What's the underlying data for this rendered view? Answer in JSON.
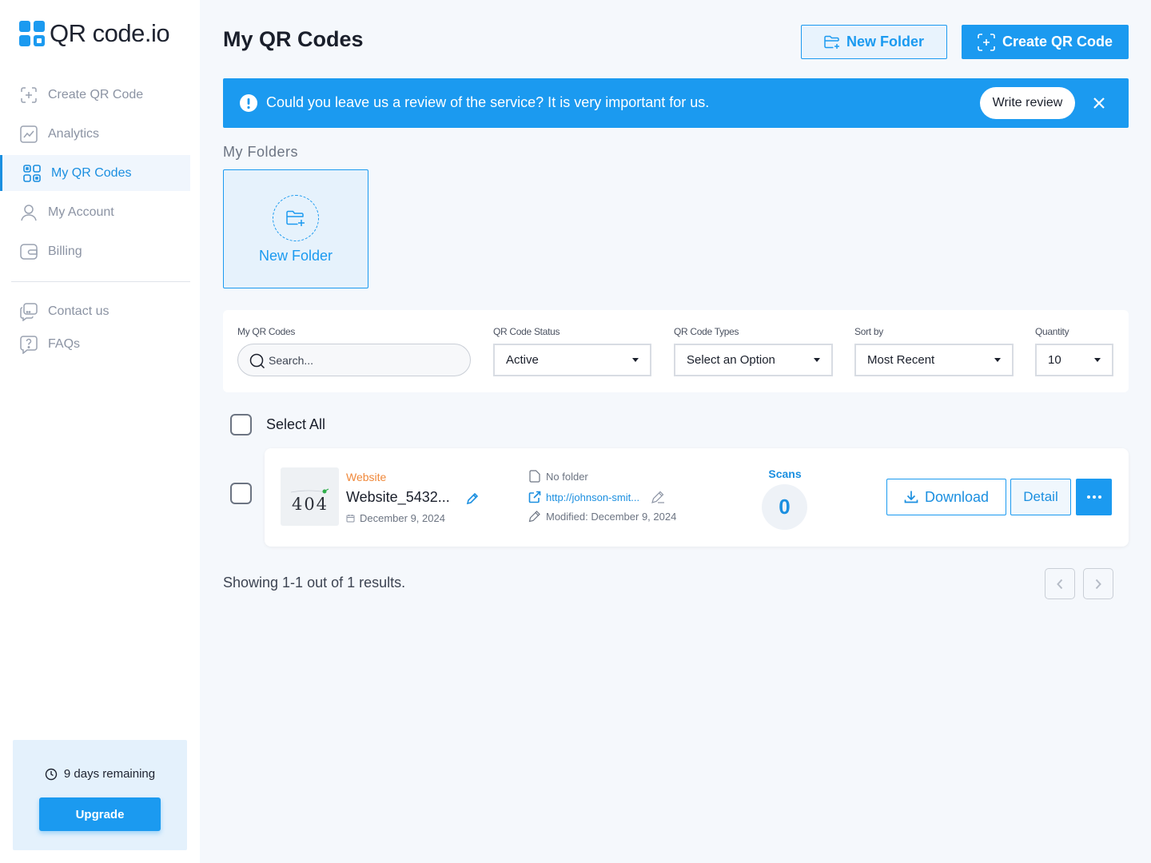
{
  "app": {
    "logo_text": "QR code.io"
  },
  "sidebar": {
    "items": [
      {
        "label": "Create QR Code",
        "icon": "plus-square-icon"
      },
      {
        "label": "Analytics",
        "icon": "chart-line-icon"
      },
      {
        "label": "My QR Codes",
        "icon": "qr-grid-icon",
        "active": true
      },
      {
        "label": "My Account",
        "icon": "user-icon"
      },
      {
        "label": "Billing",
        "icon": "wallet-icon"
      }
    ],
    "secondary": [
      {
        "label": "Contact us",
        "icon": "chat-icon"
      },
      {
        "label": "FAQs",
        "icon": "question-icon"
      }
    ],
    "trial": {
      "text": "9 days remaining",
      "upgrade_label": "Upgrade"
    }
  },
  "header": {
    "title": "My QR Codes",
    "new_folder_label": "New Folder",
    "create_label": "Create QR Code"
  },
  "banner": {
    "text": "Could you leave us a review of the service? It is very important for us.",
    "review_label": "Write review"
  },
  "folders": {
    "label": "My Folders",
    "new_folder_label": "New Folder"
  },
  "filters": {
    "search_label": "My QR Codes",
    "search_placeholder": "Search...",
    "status_label": "QR Code Status",
    "status_value": "Active",
    "types_label": "QR Code Types",
    "types_value": "Select an Option",
    "sort_label": "Sort by",
    "sort_value": "Most Recent",
    "quantity_label": "Quantity",
    "quantity_value": "10"
  },
  "list": {
    "select_all_label": "Select All",
    "items": [
      {
        "type": "Website",
        "name": "Website_5432...",
        "date": "December 9, 2024",
        "folder": "No folder",
        "url": "http://johnson-smit...",
        "modified": "Modified: December 9, 2024",
        "scans_label": "Scans",
        "scans": "0",
        "thumbnail_text": "404",
        "download_label": "Download",
        "detail_label": "Detail"
      }
    ]
  },
  "pagination": {
    "results_text": "Showing 1-1 out of 1 results."
  },
  "colors": {
    "accent": "#1b9af0",
    "accent_dark": "#1b8fe0",
    "type_label": "#f0883a",
    "background": "#f5f8fc"
  }
}
